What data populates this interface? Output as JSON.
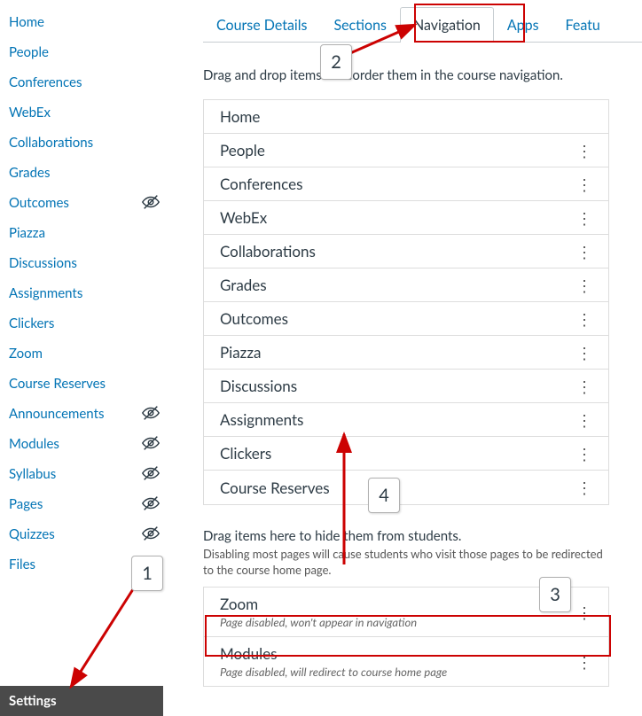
{
  "sidebar": {
    "items": [
      {
        "label": "Home",
        "hidden": false
      },
      {
        "label": "People",
        "hidden": false
      },
      {
        "label": "Conferences",
        "hidden": false
      },
      {
        "label": "WebEx",
        "hidden": false
      },
      {
        "label": "Collaborations",
        "hidden": false
      },
      {
        "label": "Grades",
        "hidden": false
      },
      {
        "label": "Outcomes",
        "hidden": true
      },
      {
        "label": "Piazza",
        "hidden": false
      },
      {
        "label": "Discussions",
        "hidden": false
      },
      {
        "label": "Assignments",
        "hidden": false
      },
      {
        "label": "Clickers",
        "hidden": false
      },
      {
        "label": "Zoom",
        "hidden": false
      },
      {
        "label": "Course Reserves",
        "hidden": false
      },
      {
        "label": "Announcements",
        "hidden": true
      },
      {
        "label": "Modules",
        "hidden": true
      },
      {
        "label": "Syllabus",
        "hidden": true
      },
      {
        "label": "Pages",
        "hidden": true
      },
      {
        "label": "Quizzes",
        "hidden": true
      },
      {
        "label": "Files",
        "hidden": true
      }
    ],
    "settings_label": "Settings"
  },
  "tabs": [
    {
      "label": "Course Details",
      "active": false
    },
    {
      "label": "Sections",
      "active": false
    },
    {
      "label": "Navigation",
      "active": true
    },
    {
      "label": "Apps",
      "active": false
    },
    {
      "label": "Featu",
      "active": false
    }
  ],
  "instructions": "Drag and drop items to reorder them in the course navigation.",
  "enabled_items": [
    {
      "label": "Home",
      "menu": false
    },
    {
      "label": "People",
      "menu": true
    },
    {
      "label": "Conferences",
      "menu": true
    },
    {
      "label": "WebEx",
      "menu": true
    },
    {
      "label": "Collaborations",
      "menu": true
    },
    {
      "label": "Grades",
      "menu": true
    },
    {
      "label": "Outcomes",
      "menu": true
    },
    {
      "label": "Piazza",
      "menu": true
    },
    {
      "label": "Discussions",
      "menu": true
    },
    {
      "label": "Assignments",
      "menu": true
    },
    {
      "label": "Clickers",
      "menu": true
    },
    {
      "label": "Course Reserves",
      "menu": true
    }
  ],
  "hidden_section": {
    "title": "Drag items here to hide them from students.",
    "subtitle": "Disabling most pages will cause students who visit those pages to be redirected to the course home page.",
    "items": [
      {
        "label": "Zoom",
        "sub": "Page disabled, won't appear in navigation"
      },
      {
        "label": "Modules",
        "sub": "Page disabled, will redirect to course home page"
      }
    ]
  },
  "callouts": {
    "c1": "1",
    "c2": "2",
    "c3": "3",
    "c4": "4"
  }
}
